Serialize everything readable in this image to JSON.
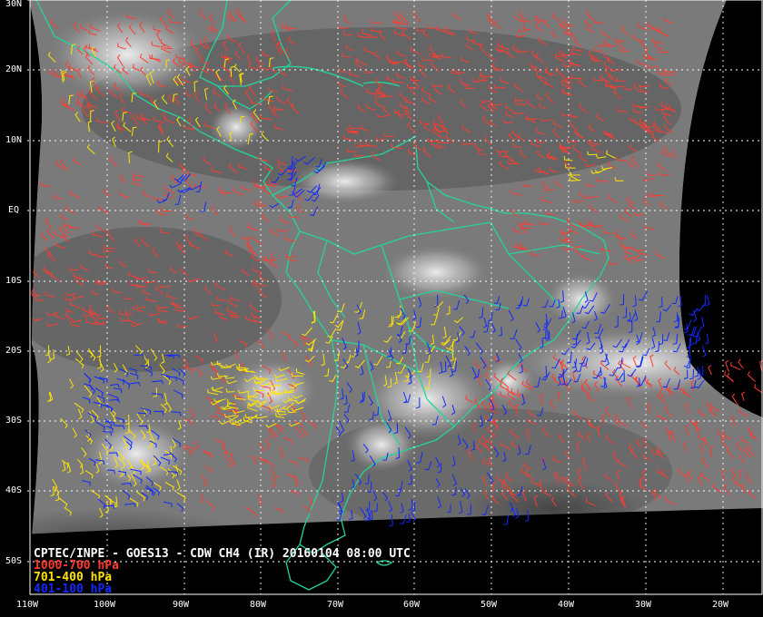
{
  "caption": {
    "title": "CPTEC/INPE - GOES13 - CDW CH4 (IR) 20160104 08:00 UTC",
    "legend": [
      {
        "text": "1000-700 hPa",
        "color": "#ff3b30"
      },
      {
        "text": "701-400 hPa",
        "color": "#ffe400"
      },
      {
        "text": "401-100 hPa",
        "color": "#1029ff"
      }
    ]
  },
  "lat_labels": [
    "30N",
    "20N",
    "10N",
    "EQ",
    "10S",
    "20S",
    "30S",
    "40S",
    "50S"
  ],
  "lon_labels": [
    "110W",
    "100W",
    "90W",
    "80W",
    "70W",
    "60W",
    "50W",
    "40W",
    "30W",
    "20W"
  ],
  "colors": {
    "coastline": "#25d49a",
    "grid": "#ffffff",
    "space": "#000000",
    "low_level": "#ff3b30",
    "mid_level": "#ffe400",
    "high_level": "#1029ff"
  },
  "map": {
    "projection": "geostationary",
    "lat_range": [
      -55,
      30
    ],
    "lon_range": [
      -110,
      -15
    ],
    "grid_step_deg": 10
  }
}
